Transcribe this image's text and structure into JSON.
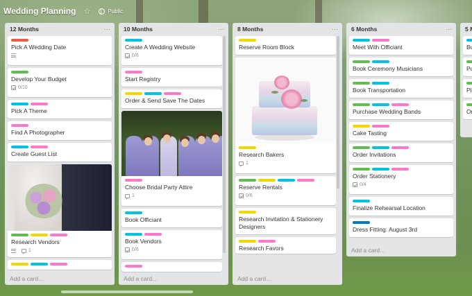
{
  "board": {
    "title": "Wedding Planning",
    "visibility": "Public"
  },
  "colors": {
    "red": "#eb5a46",
    "green": "#61bd4f",
    "yellow": "#f2d600",
    "blue": "#00c2e0",
    "pink": "#ff78cb",
    "navy": "#0079bf"
  },
  "add_card_label": "Add a card…",
  "lists": [
    {
      "title": "12 Months",
      "cards": [
        {
          "title": "Pick A Wedding Date",
          "labels": [
            "red"
          ],
          "badges": {
            "description": true
          }
        },
        {
          "title": "Develop Your Budget",
          "labels": [
            "green"
          ],
          "badges": {
            "checklist": "0/10"
          }
        },
        {
          "title": "Pick A Theme",
          "labels": [
            "blue",
            "pink"
          ]
        },
        {
          "title": "Find A Photographer",
          "labels": [
            "pink"
          ]
        },
        {
          "title": "Create Guest List",
          "labels": [
            "blue",
            "pink"
          ]
        },
        {
          "title": "Research Vendors",
          "labels": [
            "green",
            "yellow",
            "pink"
          ],
          "badges": {
            "description": true,
            "comments": "1"
          }
        },
        {
          "title": "",
          "labels": [
            "yellow",
            "blue",
            "pink"
          ]
        }
      ]
    },
    {
      "title": "10 Months",
      "cards": [
        {
          "title": "Create A Wedding Website",
          "labels": [
            "blue"
          ],
          "badges": {
            "checklist": "0/6"
          }
        },
        {
          "title": "Start Registry",
          "labels": [
            "pink"
          ]
        },
        {
          "title": "Order & Send Save The Dates",
          "labels": [
            "yellow",
            "blue",
            "pink"
          ]
        },
        {
          "title": "Choose Bridal Party Attire",
          "labels": [
            "pink"
          ],
          "badges": {
            "comments": "1"
          }
        },
        {
          "title": "Book Officiant",
          "labels": [
            "blue"
          ]
        },
        {
          "title": "Book Vendors",
          "labels": [
            "blue",
            "pink"
          ],
          "badges": {
            "checklist": "0/6"
          }
        },
        {
          "title": "",
          "labels": [
            "pink"
          ]
        }
      ]
    },
    {
      "title": "8 Months",
      "cards": [
        {
          "title": "Reserve Room Block",
          "labels": [
            "yellow"
          ]
        },
        {
          "title": "Research Bakers",
          "labels": [
            "yellow"
          ],
          "badges": {
            "comments": "1"
          }
        },
        {
          "title": "Reserve Rentals",
          "labels": [
            "green",
            "yellow",
            "blue",
            "pink"
          ],
          "badges": {
            "checklist": "0/6"
          }
        },
        {
          "title": "Research Invitation & Stationery Designers",
          "labels": [
            "yellow"
          ]
        },
        {
          "title": "Research Favors",
          "labels": [
            "yellow",
            "pink"
          ]
        }
      ]
    },
    {
      "title": "6 Months",
      "cards": [
        {
          "title": "Meet With Officiant",
          "labels": [
            "blue",
            "pink"
          ]
        },
        {
          "title": "Book Ceremony Musicians",
          "labels": [
            "green",
            "blue"
          ]
        },
        {
          "title": "Book Transportation",
          "labels": [
            "green",
            "blue"
          ]
        },
        {
          "title": "Purchase Wedding Bands",
          "labels": [
            "green",
            "blue",
            "pink"
          ]
        },
        {
          "title": "Cake Tasting",
          "labels": [
            "yellow",
            "pink"
          ]
        },
        {
          "title": "Order Invitations",
          "labels": [
            "green",
            "blue",
            "pink"
          ]
        },
        {
          "title": "Order Stationery",
          "labels": [
            "green",
            "blue",
            "pink"
          ],
          "badges": {
            "checklist": "0/4"
          }
        },
        {
          "title": "Finalize Rehearsal Location",
          "labels": [
            "blue"
          ]
        },
        {
          "title": "Dress Fitting: August 3rd",
          "labels": [
            "navy"
          ]
        }
      ]
    },
    {
      "title": "5 M",
      "cards": [
        {
          "title": "Bu",
          "labels": [
            "blue"
          ]
        },
        {
          "title": "Pu",
          "labels": [
            "green"
          ]
        },
        {
          "title": "Pla",
          "labels": [
            "green"
          ]
        },
        {
          "title": "Or",
          "labels": [
            "green"
          ]
        }
      ]
    }
  ]
}
